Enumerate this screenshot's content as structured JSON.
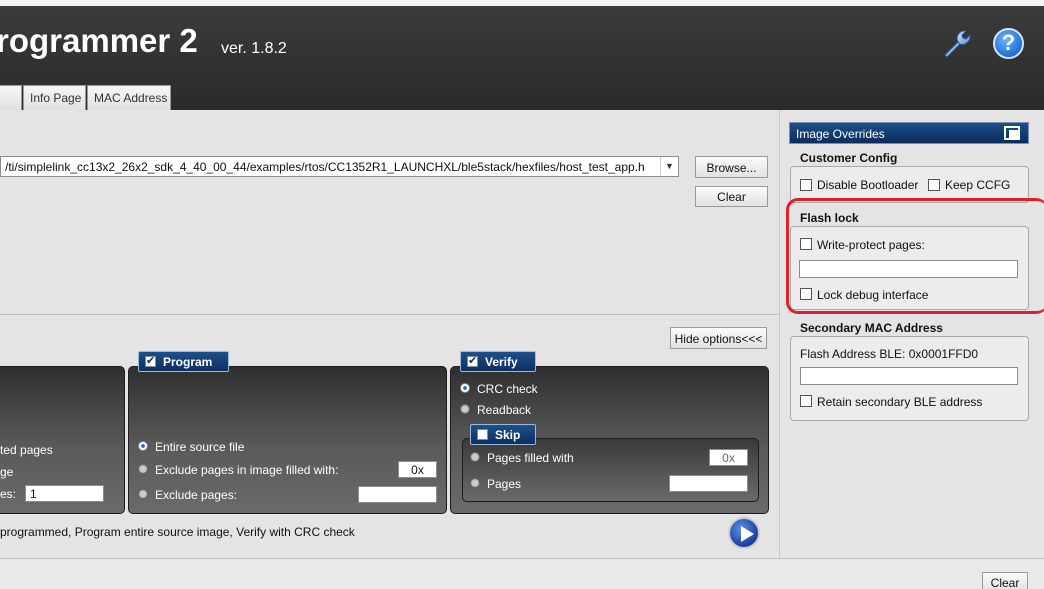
{
  "header": {
    "title": "rogrammer 2",
    "version": "ver. 1.8.2",
    "wrench_icon": "wrench-icon",
    "help_icon": "help-icon",
    "help_symbol": "?"
  },
  "tabs": [
    {
      "label": ""
    },
    {
      "label": "Info Page"
    },
    {
      "label": "MAC Address"
    }
  ],
  "source": {
    "path": "/ti/simplelink_cc13x2_26x2_sdk_4_40_00_44/examples/rtos/CC1352R1_LAUNCHXL/ble5stack/hexfiles/host_test_app.hex",
    "browse_label": "Browse...",
    "clear_label": "Clear",
    "dropdown_arrow": "▼"
  },
  "options": {
    "hide_label": "Hide options<<<",
    "erase": {
      "opt1": "ted pages",
      "opt2": "ge",
      "opt3": "es:",
      "opt3_value": "1"
    },
    "program": {
      "title": "Program",
      "checked": true,
      "entire": "Entire source file",
      "exclude_filled": "Exclude pages in image filled with:",
      "exclude_filled_value": "0x",
      "exclude_pages": "Exclude pages:",
      "exclude_pages_value": ""
    },
    "verify": {
      "title": "Verify",
      "checked": true,
      "crc": "CRC check",
      "readback": "Readback"
    },
    "skip": {
      "title": "Skip",
      "checked": false,
      "filled": "Pages filled with",
      "filled_value": "0x",
      "pages": "Pages",
      "pages_value": ""
    },
    "summary": "programmed, Program entire source image, Verify with CRC check"
  },
  "overrides": {
    "title": "Image Overrides",
    "customer_config": {
      "title": "Customer Config",
      "disable_bootloader": "Disable Bootloader",
      "keep_ccfg": "Keep CCFG"
    },
    "flash_lock": {
      "title": "Flash lock",
      "write_protect": "Write-protect pages:",
      "write_protect_value": "",
      "lock_debug": "Lock debug interface"
    },
    "secondary_mac": {
      "title": "Secondary MAC Address",
      "flash_address": "Flash Address BLE: 0x0001FFD0",
      "mac_value": "",
      "retain": "Retain secondary BLE address"
    }
  },
  "bottom": {
    "clear_label": "Clear"
  },
  "colors": {
    "highlight": "#e0202a",
    "group_title": "#1e4f8a"
  }
}
